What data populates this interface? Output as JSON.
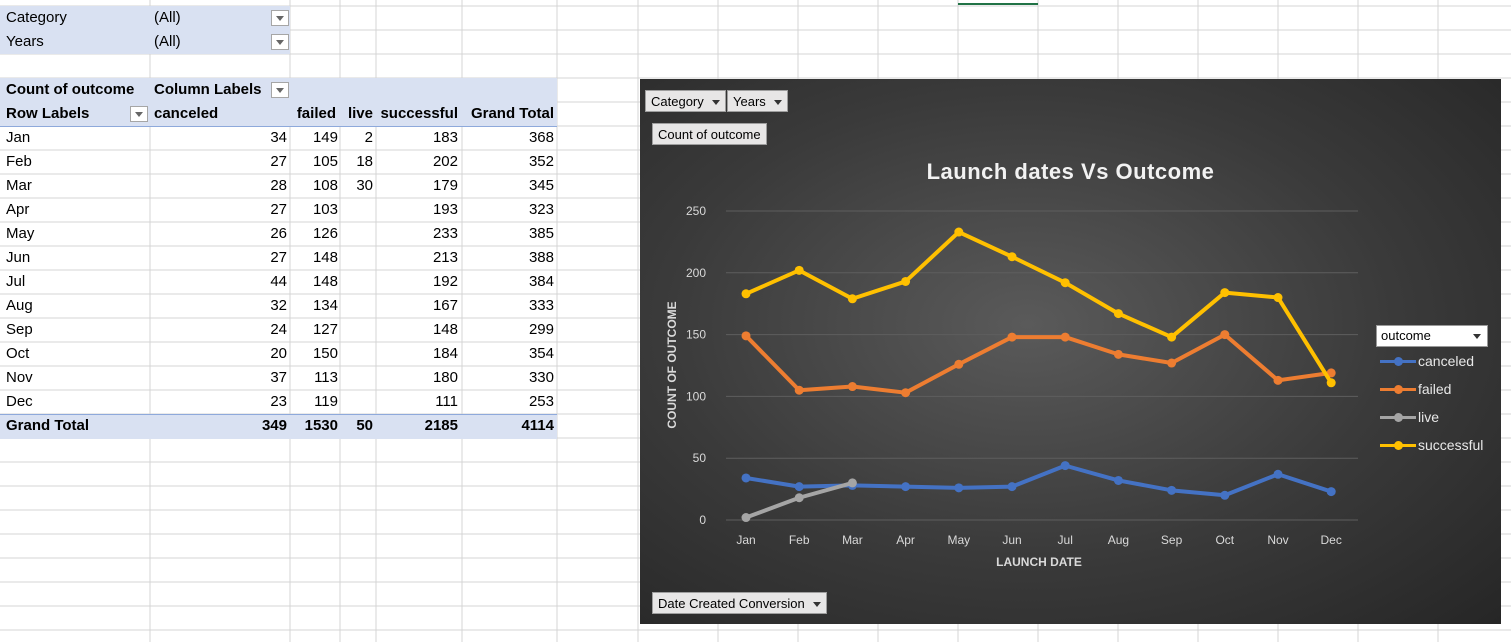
{
  "filters": [
    {
      "label": "Category",
      "value": "(All)"
    },
    {
      "label": "Years",
      "value": "(All)"
    }
  ],
  "pivot": {
    "corner_label": "Count of outcome",
    "column_labels": "Column Labels",
    "row_labels": "Row Labels",
    "columns": [
      "canceled",
      "failed",
      "live",
      "successful",
      "Grand Total"
    ],
    "rows": [
      {
        "label": "Jan",
        "values": [
          "34",
          "149",
          "2",
          "183",
          "368"
        ]
      },
      {
        "label": "Feb",
        "values": [
          "27",
          "105",
          "18",
          "202",
          "352"
        ]
      },
      {
        "label": "Mar",
        "values": [
          "28",
          "108",
          "30",
          "179",
          "345"
        ]
      },
      {
        "label": "Apr",
        "values": [
          "27",
          "103",
          "",
          "193",
          "323"
        ]
      },
      {
        "label": "May",
        "values": [
          "26",
          "126",
          "",
          "233",
          "385"
        ]
      },
      {
        "label": "Jun",
        "values": [
          "27",
          "148",
          "",
          "213",
          "388"
        ]
      },
      {
        "label": "Jul",
        "values": [
          "44",
          "148",
          "",
          "192",
          "384"
        ]
      },
      {
        "label": "Aug",
        "values": [
          "32",
          "134",
          "",
          "167",
          "333"
        ]
      },
      {
        "label": "Sep",
        "values": [
          "24",
          "127",
          "",
          "148",
          "299"
        ]
      },
      {
        "label": "Oct",
        "values": [
          "20",
          "150",
          "",
          "184",
          "354"
        ]
      },
      {
        "label": "Nov",
        "values": [
          "37",
          "113",
          "",
          "180",
          "330"
        ]
      },
      {
        "label": "Dec",
        "values": [
          "23",
          "119",
          "",
          "111",
          "253"
        ]
      }
    ],
    "grand_total": {
      "label": "Grand Total",
      "values": [
        "349",
        "1530",
        "50",
        "2185",
        "4114"
      ]
    }
  },
  "chart": {
    "filter_chips": [
      "Category",
      "Years"
    ],
    "value_chip": "Count of outcome",
    "axis_chip": "Date Created Conversion",
    "legend_field": "outcome"
  },
  "chart_data": {
    "type": "line",
    "title": "Launch dates Vs Outcome",
    "xlabel": "LAUNCH DATE",
    "ylabel": "COUNT OF OUTCOME",
    "categories": [
      "Jan",
      "Feb",
      "Mar",
      "Apr",
      "May",
      "Jun",
      "Jul",
      "Aug",
      "Sep",
      "Oct",
      "Nov",
      "Dec"
    ],
    "ylim": [
      0,
      250
    ],
    "yticks": [
      0,
      50,
      100,
      150,
      200,
      250
    ],
    "grid": true,
    "legend_position": "right",
    "series": [
      {
        "name": "canceled",
        "color": "#4472c4",
        "values": [
          34,
          27,
          28,
          27,
          26,
          27,
          44,
          32,
          24,
          20,
          37,
          23
        ]
      },
      {
        "name": "failed",
        "color": "#ed7d31",
        "values": [
          149,
          105,
          108,
          103,
          126,
          148,
          148,
          134,
          127,
          150,
          113,
          119
        ]
      },
      {
        "name": "live",
        "color": "#a5a5a5",
        "values": [
          2,
          18,
          30,
          null,
          null,
          null,
          null,
          null,
          null,
          null,
          null,
          null
        ]
      },
      {
        "name": "successful",
        "color": "#ffc000",
        "values": [
          183,
          202,
          179,
          193,
          233,
          213,
          192,
          167,
          148,
          184,
          180,
          111
        ]
      }
    ]
  }
}
